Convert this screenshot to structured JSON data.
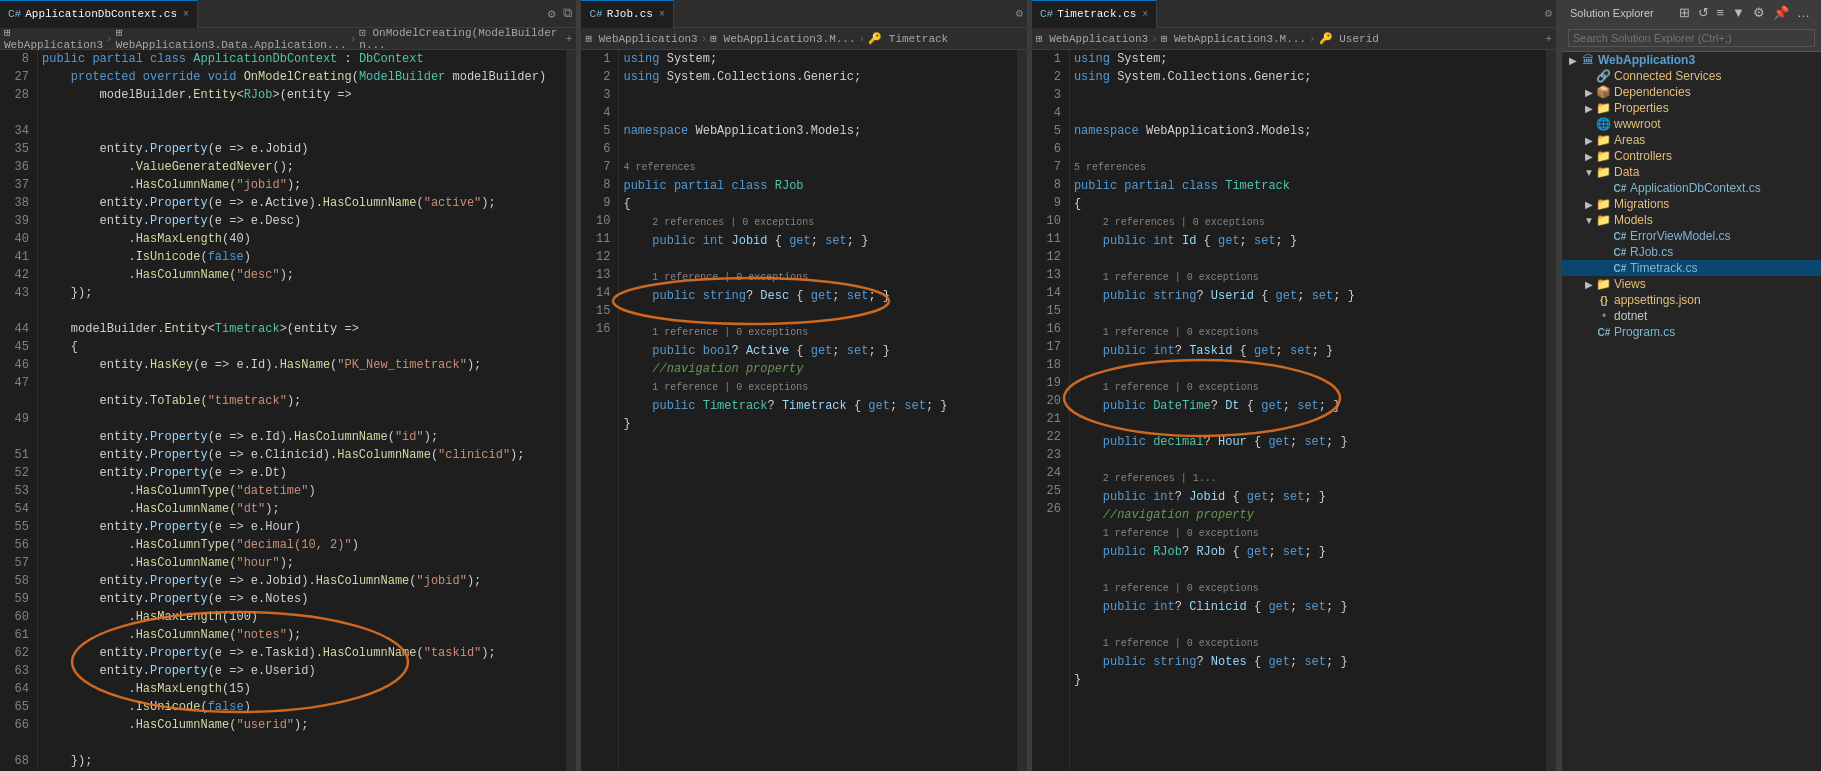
{
  "tabs": {
    "left": [
      {
        "label": "ApplicationDbContext.cs",
        "active": false,
        "icon": "C#"
      },
      {
        "label": "×",
        "isClose": true
      }
    ],
    "middle": [
      {
        "label": "RJob.cs",
        "active": false,
        "icon": "C#"
      },
      {
        "label": "×",
        "isClose": true
      }
    ],
    "right": [
      {
        "label": "Timetrack.cs",
        "active": true,
        "icon": "C#"
      },
      {
        "label": "×",
        "isClose": true
      }
    ]
  },
  "breadcrumbs": {
    "left": [
      "WebApplication3",
      "WebApplication3.Data.Application...",
      "OnModelCreating(ModelBuilder n..."
    ],
    "middle": [
      "WebApplication3",
      "WebApplication3.M...",
      "Timetrack"
    ],
    "right": [
      "WebApplication3",
      "WebApplication3.M...",
      "Userid"
    ]
  },
  "solution_explorer": {
    "title": "Solution Explorer",
    "search_placeholder": "Search Solution Explorer (Ctrl+;)",
    "tree": [
      {
        "indent": 0,
        "arrow": "▶",
        "icon": "🏠",
        "label": "WebApplication3",
        "type": "project"
      },
      {
        "indent": 1,
        "arrow": "",
        "icon": "🔗",
        "label": "Connected Services",
        "type": "folder"
      },
      {
        "indent": 1,
        "arrow": "▶",
        "icon": "📦",
        "label": "Dependencies",
        "type": "folder"
      },
      {
        "indent": 1,
        "arrow": "▶",
        "icon": "📁",
        "label": "Properties",
        "type": "folder"
      },
      {
        "indent": 1,
        "arrow": "",
        "icon": "🌐",
        "label": "wwwroot",
        "type": "folder"
      },
      {
        "indent": 1,
        "arrow": "▶",
        "icon": "📁",
        "label": "Areas",
        "type": "folder"
      },
      {
        "indent": 1,
        "arrow": "▶",
        "icon": "📁",
        "label": "Controllers",
        "type": "folder"
      },
      {
        "indent": 1,
        "arrow": "▼",
        "icon": "📁",
        "label": "Data",
        "type": "folder"
      },
      {
        "indent": 2,
        "arrow": "",
        "icon": "C#",
        "label": "ApplicationDbContext.cs",
        "type": "cs"
      },
      {
        "indent": 1,
        "arrow": "▼",
        "icon": "📁",
        "label": "Migrations",
        "type": "folder"
      },
      {
        "indent": 1,
        "arrow": "▼",
        "icon": "📁",
        "label": "Models",
        "type": "folder"
      },
      {
        "indent": 2,
        "arrow": "",
        "icon": "C#",
        "label": "ErrorViewModel.cs",
        "type": "cs"
      },
      {
        "indent": 2,
        "arrow": "",
        "icon": "C#",
        "label": "RJob.cs",
        "type": "cs"
      },
      {
        "indent": 2,
        "arrow": "",
        "icon": "C#",
        "label": "Timetrack.cs",
        "type": "cs",
        "selected": true
      },
      {
        "indent": 1,
        "arrow": "▶",
        "icon": "📁",
        "label": "Views",
        "type": "folder"
      },
      {
        "indent": 1,
        "arrow": "",
        "icon": "JSON",
        "label": "appsettings.json",
        "type": "json"
      },
      {
        "indent": 1,
        "arrow": "",
        "icon": "•",
        "label": "dotnet",
        "type": "text"
      },
      {
        "indent": 1,
        "arrow": "",
        "icon": "C#",
        "label": "Program.cs",
        "type": "cs"
      }
    ]
  }
}
